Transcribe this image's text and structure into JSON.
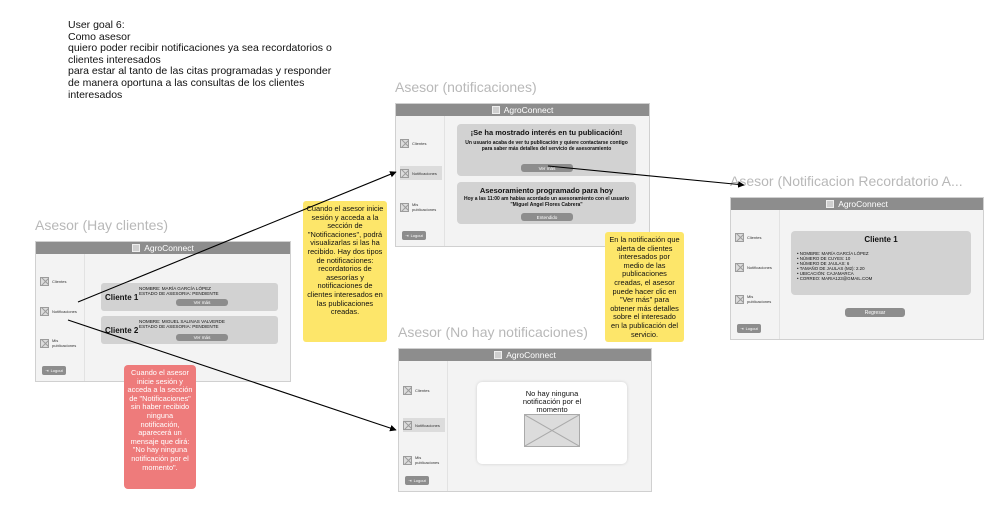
{
  "user_goal": {
    "lines": [
      "User goal 6:",
      "Como asesor",
      "quiero poder recibir notificaciones ya sea recordatorios o",
      "clientes interesados",
      "para estar al tanto de las citas programadas y responder",
      "de manera oportuna a las consultas de los clientes",
      "interesados"
    ]
  },
  "app_name": "AgroConnect",
  "sidebar": {
    "clients": "Clientes",
    "notifications": "Notificaciones",
    "publications": "Mis publicaciones",
    "logout": "Logout"
  },
  "frames": {
    "hay_clientes": {
      "title": "Asesor (Hay clientes)",
      "clients": [
        {
          "label": "Cliente 1",
          "name": "NOMBRE: MARÍA GARCÍA LÓPEZ",
          "status": "ESTADO DE ASESORIA: PENDIENTE",
          "button": "Ver más"
        },
        {
          "label": "Cliente 2",
          "name": "NOMBRE: MIGUEL SALINAS VALVERDE",
          "status": "ESTADO DE ASESORIA: PENDIENTE",
          "button": "Ver más"
        }
      ]
    },
    "notificaciones": {
      "title": "Asesor (notificaciones)",
      "cards": [
        {
          "title": "¡Se ha mostrado interés en tu publicación!",
          "body": "Un usuario acaba de ver tu publicación y quiere contactarse contigo para saber más detalles del servicio de asesoramiento",
          "button": "Ver más"
        },
        {
          "title": "Asesoramiento programado para hoy",
          "body": "Hoy a las 11:00 am habías acordado un asesoramiento con el usuario \"Miguel Angel Flores Cabrera\"",
          "button": "Entendido"
        }
      ]
    },
    "recordatorio": {
      "title": "Asesor (Notificacion Recordatorio A...",
      "card_title": "Cliente 1",
      "details": [
        "NOMBRE: MARÍA GARCÍA LÓPEZ",
        "NÚMERO DE CUYES: 10",
        "NÚMERO DE JAULAS: 6",
        "TAMAÑO DE JAULAS (M2): 2.20",
        "UBICACIÓN: CAJAMARCA",
        "CORREO: MARIA123@GMAIL.COM"
      ],
      "button": "Regresar"
    },
    "no_hay": {
      "title": "Asesor (No hay notificaciones)",
      "message": "No hay ninguna notificación por el momento"
    }
  },
  "notes": {
    "yellow_1": "Cuando el asesor inicie sesión y acceda a la sección de \"Notificaciones\", podrá visualizarlas si las ha recibido. Hay dos tipos de notificaciones: recordatorios de asesorías y notificaciones de clientes interesados en las publicaciones creadas.",
    "yellow_2": "En la notificación que alerta de clientes interesados por medio de las publicaciones creadas, el asesor puede hacer clic en \"Ver más\" para obtener más detalles sobre el interesado en la publicación del servicio.",
    "red_1": "Cuando el asesor inicie sesión y acceda a la sección de \"Notificaciones\" sin haber recibido ninguna notificación, aparecerá un mensaje que dirá: \"No hay ninguna notificación por el momento\"."
  },
  "colors": {
    "header": "#8d8d8d",
    "sticky_yellow": "#fde66a",
    "sticky_red": "#ee7b7b",
    "frame_title": "#b8b8b8"
  }
}
